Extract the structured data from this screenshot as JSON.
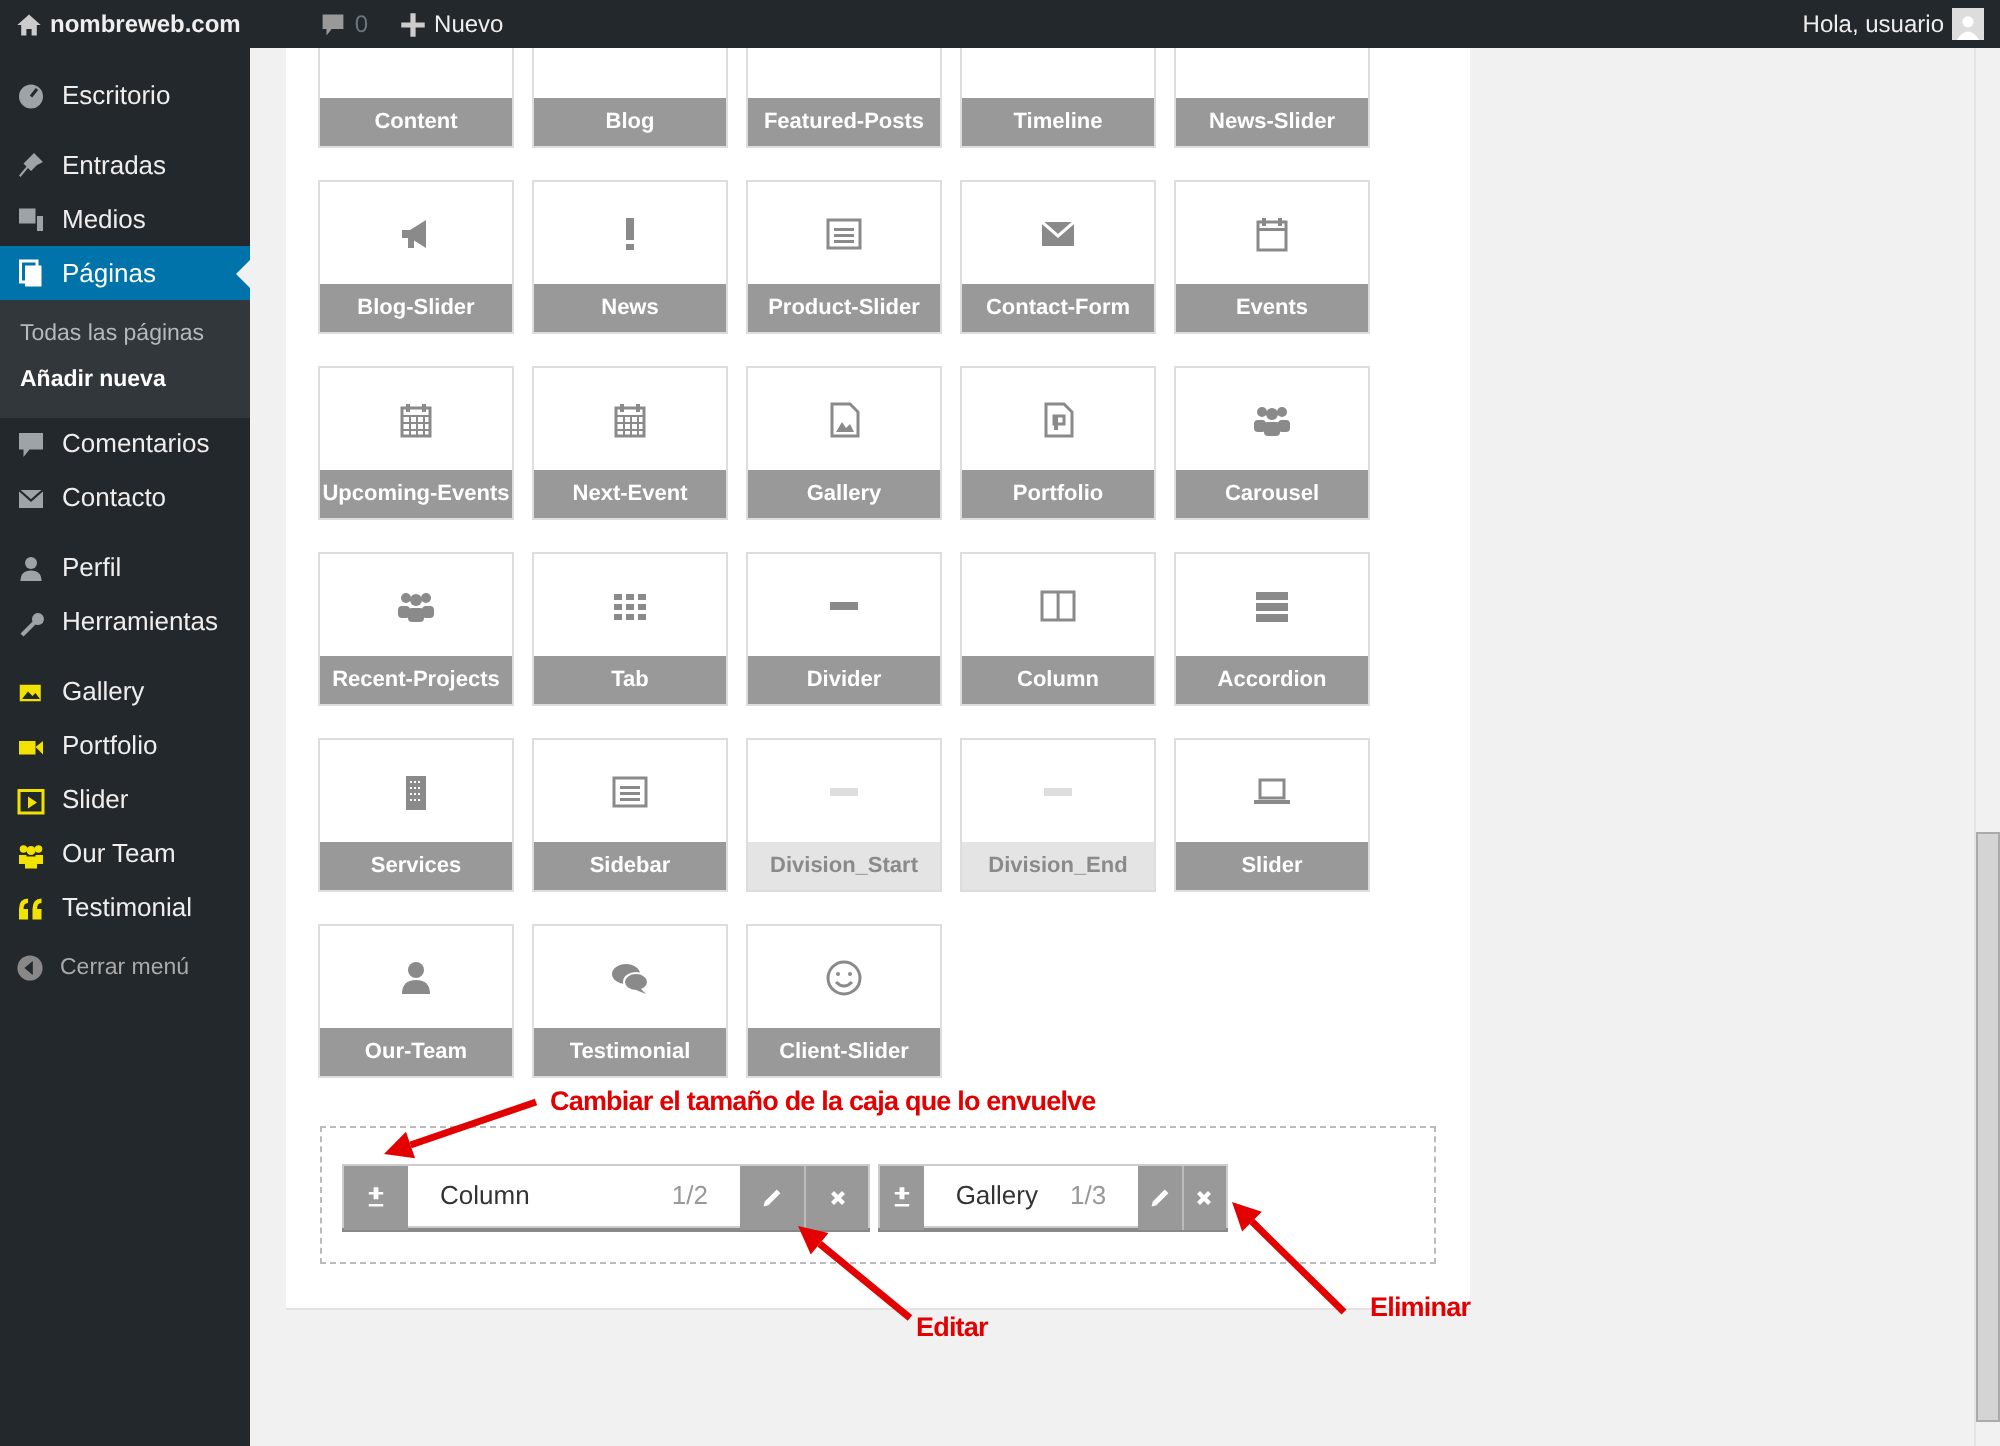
{
  "topbar": {
    "site": "nombreweb.com",
    "comments": "0",
    "new": "Nuevo",
    "greeting": "Hola, usuario"
  },
  "sidebar": {
    "groups": [
      {
        "items": [
          {
            "label": "Escritorio",
            "kind": "core",
            "selected": false
          }
        ]
      },
      {
        "items": [
          {
            "label": "Entradas",
            "kind": "core",
            "selected": false
          },
          {
            "label": "Medios",
            "kind": "core",
            "selected": false
          },
          {
            "label": "Páginas",
            "kind": "core",
            "selected": true,
            "children": [
              {
                "label": "Todas las páginas",
                "selected": false
              },
              {
                "label": "Añadir nueva",
                "selected": true
              }
            ]
          },
          {
            "label": "Comentarios",
            "kind": "core",
            "selected": false
          },
          {
            "label": "Contacto",
            "kind": "core",
            "selected": false
          }
        ]
      },
      {
        "items": [
          {
            "label": "Perfil",
            "kind": "core",
            "selected": false
          },
          {
            "label": "Herramientas",
            "kind": "core",
            "selected": false
          }
        ]
      },
      {
        "items": [
          {
            "label": "Gallery",
            "kind": "plugin",
            "selected": false
          },
          {
            "label": "Portfolio",
            "kind": "plugin",
            "selected": false
          },
          {
            "label": "Slider",
            "kind": "plugin",
            "selected": false
          },
          {
            "label": "Our Team",
            "kind": "plugin",
            "selected": false
          },
          {
            "label": "Testimonial",
            "kind": "plugin",
            "selected": false
          }
        ]
      }
    ],
    "collapse": "Cerrar menú"
  },
  "elements": [
    {
      "label": "Content",
      "disabled": false
    },
    {
      "label": "Blog",
      "disabled": false
    },
    {
      "label": "Featured-Posts",
      "disabled": false
    },
    {
      "label": "Timeline",
      "disabled": false
    },
    {
      "label": "News-Slider",
      "disabled": false
    },
    {
      "label": "Blog-Slider",
      "disabled": false
    },
    {
      "label": "News",
      "disabled": false
    },
    {
      "label": "Product-Slider",
      "disabled": false
    },
    {
      "label": "Contact-Form",
      "disabled": false
    },
    {
      "label": "Events",
      "disabled": false
    },
    {
      "label": "Upcoming-Events",
      "disabled": false
    },
    {
      "label": "Next-Event",
      "disabled": false
    },
    {
      "label": "Gallery",
      "disabled": false
    },
    {
      "label": "Portfolio",
      "disabled": false
    },
    {
      "label": "Carousel",
      "disabled": false
    },
    {
      "label": "Recent-Projects",
      "disabled": false
    },
    {
      "label": "Tab",
      "disabled": false
    },
    {
      "label": "Divider",
      "disabled": false
    },
    {
      "label": "Column",
      "disabled": false
    },
    {
      "label": "Accordion",
      "disabled": false
    },
    {
      "label": "Services",
      "disabled": false
    },
    {
      "label": "Sidebar",
      "disabled": false
    },
    {
      "label": "Division_Start",
      "disabled": true
    },
    {
      "label": "Division_End",
      "disabled": true
    },
    {
      "label": "Slider",
      "disabled": false
    },
    {
      "label": "Our-Team",
      "disabled": false
    },
    {
      "label": "Testimonial",
      "disabled": false
    },
    {
      "label": "Client-Slider",
      "disabled": false
    }
  ],
  "layout": {
    "items": [
      {
        "label": "Column",
        "size": "1/2"
      },
      {
        "label": "Gallery",
        "size": "1/3"
      }
    ]
  },
  "annotations": [
    {
      "text": "Cambiar el tamaño de la caja que lo envuelve"
    },
    {
      "text": "Editar"
    },
    {
      "text": "Eliminar"
    }
  ]
}
